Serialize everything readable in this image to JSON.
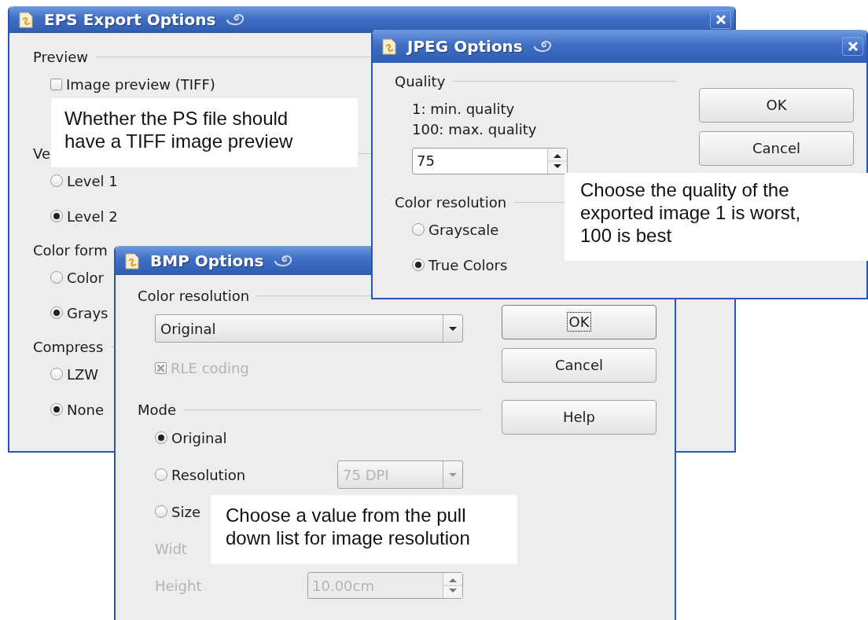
{
  "windows": [
    {
      "kind": "eps",
      "title": "EPS Export Options",
      "items": [
        {
          "kind": "section",
          "label": "Preview"
        },
        {
          "kind": "checkbox",
          "label": "Image preview (TIFF)",
          "checked": false
        },
        {
          "kind": "section",
          "label": "Ve"
        },
        {
          "kind": "radio",
          "label": "Level 1",
          "selected": false
        },
        {
          "kind": "radio",
          "label": "Level 2",
          "selected": true
        },
        {
          "kind": "section",
          "label": "Color form"
        },
        {
          "kind": "radio",
          "label": "Color",
          "selected": false
        },
        {
          "kind": "radio",
          "label": "Grays",
          "selected": true
        },
        {
          "kind": "section",
          "label": "Compress"
        },
        {
          "kind": "radio",
          "label": "LZW",
          "selected": false
        },
        {
          "kind": "radio",
          "label": "None",
          "selected": true
        }
      ]
    },
    {
      "kind": "bmp",
      "title": "BMP Options",
      "items": [
        {
          "kind": "section",
          "label": "Color resolution"
        },
        {
          "kind": "dropdown",
          "value": "Original",
          "disabled": false
        },
        {
          "kind": "checkbox",
          "label": "RLE coding",
          "checked": true,
          "disabled": true
        },
        {
          "kind": "section",
          "label": "Mode"
        },
        {
          "kind": "radio",
          "label": "Original",
          "selected": true,
          "disabled": false
        },
        {
          "kind": "radio",
          "label": "Resolution",
          "selected": false,
          "disabled": false,
          "control": {
            "kind": "dropdown",
            "value": "75 DPI",
            "disabled": true
          }
        },
        {
          "kind": "radio",
          "label": "Size",
          "selected": false,
          "disabled": false
        },
        {
          "kind": "label",
          "label": "Widt",
          "disabled": true
        },
        {
          "kind": "label",
          "label": "Height",
          "disabled": true,
          "control": {
            "kind": "spin",
            "value": "10.00cm",
            "disabled": true
          }
        }
      ],
      "buttons": [
        {
          "label": "OK",
          "focused": true
        },
        {
          "label": "Cancel",
          "focused": false
        },
        {
          "label": "Help",
          "focused": false
        }
      ]
    },
    {
      "kind": "jpeg",
      "title": "JPEG Options",
      "items": [
        {
          "kind": "section",
          "label": "Quality"
        },
        {
          "kind": "text",
          "label": "1: min. quality"
        },
        {
          "kind": "text",
          "label": "100: max. quality"
        },
        {
          "kind": "spin",
          "value": "75",
          "disabled": false
        },
        {
          "kind": "section",
          "label": "Color resolution"
        },
        {
          "kind": "radio",
          "label": "Grayscale",
          "selected": false
        },
        {
          "kind": "radio",
          "label": "True Colors",
          "selected": true
        }
      ],
      "buttons": [
        {
          "label": "OK",
          "focused": false
        },
        {
          "label": "Cancel",
          "focused": false
        }
      ]
    }
  ],
  "callouts": [
    {
      "text": "Whether the PS file should have a TIFF image preview"
    },
    {
      "text": "Choose the quality of the exported image 1 is worst, 100 is best"
    },
    {
      "text": "Choose a value from the pull down list for image resolution"
    }
  ]
}
